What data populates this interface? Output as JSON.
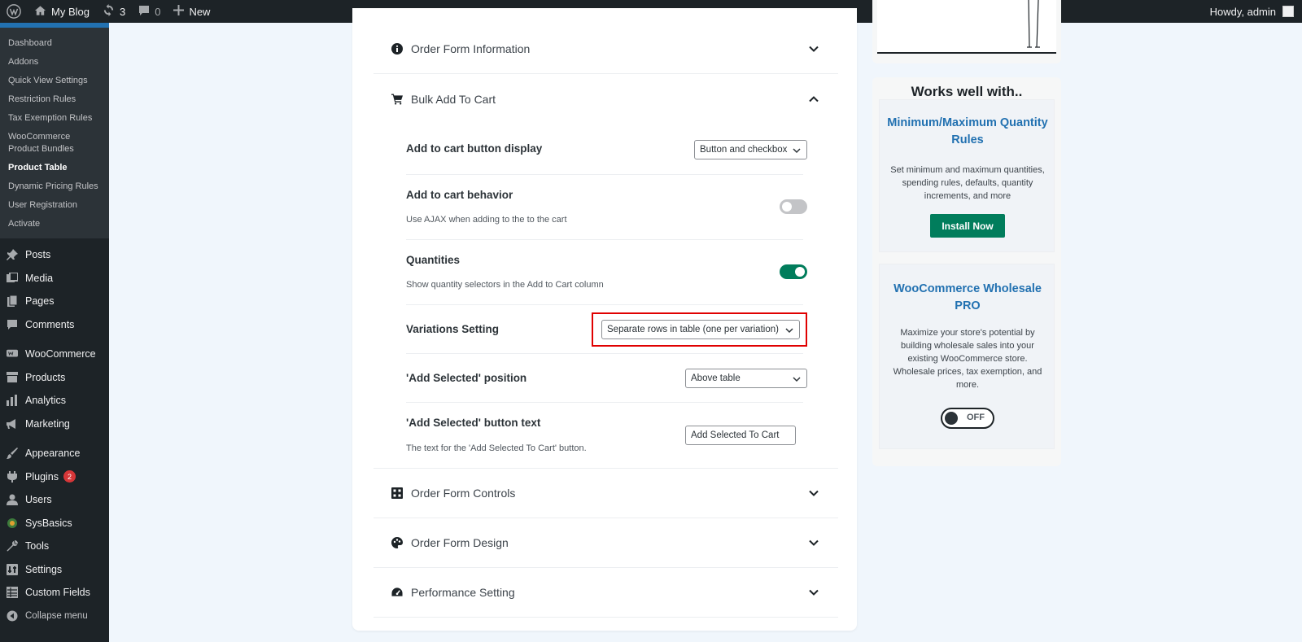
{
  "adminbar": {
    "site_name": "My Blog",
    "updates_count": "3",
    "comments_count": "0",
    "new_label": "New",
    "howdy": "Howdy, admin"
  },
  "sidebar": {
    "submenu": [
      {
        "label": "Dashboard",
        "current": false
      },
      {
        "label": "Addons",
        "current": false
      },
      {
        "label": "Quick View Settings",
        "current": false
      },
      {
        "label": "Restriction Rules",
        "current": false
      },
      {
        "label": "Tax Exemption Rules",
        "current": false
      },
      {
        "label": "WooCommerce Product Bundles",
        "current": false
      },
      {
        "label": "Product Table",
        "current": true
      },
      {
        "label": "Dynamic Pricing Rules",
        "current": false
      },
      {
        "label": "User Registration",
        "current": false
      },
      {
        "label": "Activate",
        "current": false
      }
    ],
    "menu": {
      "posts": "Posts",
      "media": "Media",
      "pages": "Pages",
      "comments": "Comments",
      "woocommerce": "WooCommerce",
      "products": "Products",
      "analytics": "Analytics",
      "marketing": "Marketing",
      "appearance": "Appearance",
      "plugins": "Plugins",
      "plugins_badge": "2",
      "users": "Users",
      "sysbasics": "SysBasics",
      "tools": "Tools",
      "settings": "Settings",
      "custom_fields": "Custom Fields",
      "collapse": "Collapse menu"
    }
  },
  "main": {
    "sections": {
      "order_form_information": "Order Form Information",
      "bulk_add_to_cart": "Bulk Add To Cart",
      "order_form_controls": "Order Form Controls",
      "order_form_design": "Order Form Design",
      "performance_setting": "Performance Setting"
    },
    "settings": {
      "add_to_cart_display": {
        "label": "Add to cart button display",
        "value": "Button and checkbox"
      },
      "add_to_cart_behavior": {
        "label": "Add to cart behavior",
        "description": "Use AJAX when adding to the to the cart",
        "enabled": false
      },
      "quantities": {
        "label": "Quantities",
        "description": "Show quantity selectors in the Add to Cart column",
        "enabled": true
      },
      "variations_setting": {
        "label": "Variations Setting",
        "value": "Separate rows in table (one per variation)"
      },
      "add_selected_position": {
        "label": "'Add Selected' position",
        "value": "Above table"
      },
      "add_selected_text": {
        "label": "'Add Selected' button text",
        "description": "The text for the 'Add Selected To Cart' button.",
        "value": "Add Selected To Cart"
      }
    }
  },
  "side": {
    "title": "Works well with..",
    "plugins": [
      {
        "name": "Minimum/Maximum Quantity Rules",
        "description": "Set minimum and maximum quantities, spending rules, defaults, quantity increments, and more",
        "button": "Install Now"
      },
      {
        "name": "WooCommerce Wholesale PRO",
        "description": "Maximize your store's potential by building wholesale sales into your existing WooCommerce store. Wholesale prices, tax exemption, and more.",
        "toggle_label": "OFF",
        "enabled": false
      }
    ]
  },
  "colors": {
    "accent": "#2271b1",
    "brand_green": "#017d5c",
    "highlight": "#e00000",
    "adminbar_bg": "#1d2327"
  }
}
